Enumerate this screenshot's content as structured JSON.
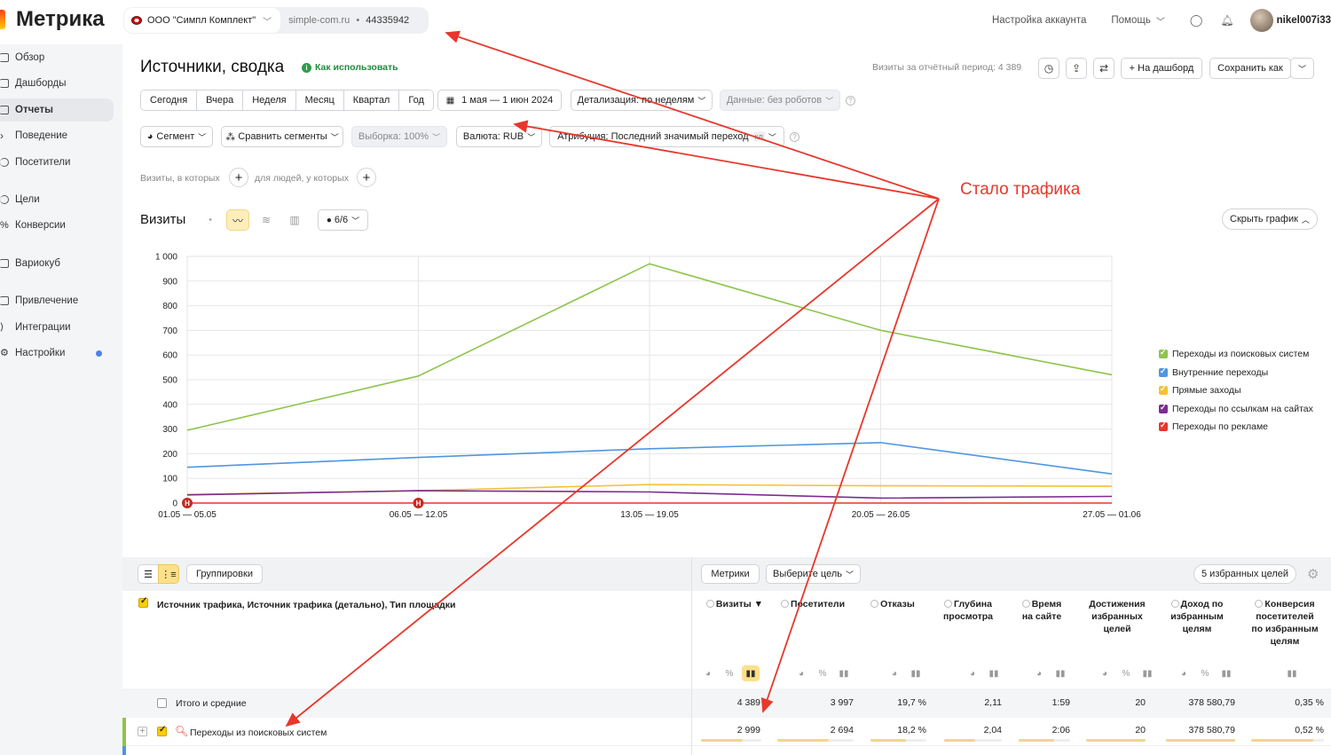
{
  "app": {
    "logo": "Метрика"
  },
  "counter": {
    "org": "ООО \"Симпл Комплект\"",
    "site": "simple-com.ru",
    "separator": "•",
    "id": "44335942"
  },
  "header": {
    "account_settings": "Настройка аккаунта",
    "help": "Помощь",
    "user": "nikel007i33"
  },
  "sidebar": {
    "items": [
      {
        "label": "Обзор"
      },
      {
        "label": "Дашборды"
      },
      {
        "label": "Отчеты"
      },
      {
        "label": "Поведение"
      },
      {
        "label": "Посетители"
      },
      {
        "label": "Цели"
      },
      {
        "label": "Конверсии"
      },
      {
        "label": "Вариокуб"
      },
      {
        "label": "Привлечение"
      },
      {
        "label": "Интеграции"
      },
      {
        "label": "Настройки"
      }
    ],
    "active_index": 2
  },
  "page": {
    "title": "Источники, сводка",
    "how_to": "Как использовать",
    "period_visits": "Визиты за отчётный период: 4 389",
    "to_dashboard": "+ На дашборд",
    "save_as": "Сохранить как"
  },
  "period_buttons": [
    "Сегодня",
    "Вчера",
    "Неделя",
    "Месяц",
    "Квартал",
    "Год"
  ],
  "date_range": "1 мая — 1 июн 2024",
  "detail": "Детализация: по неделям",
  "data_robots": "Данные: без роботов",
  "segment": "Сегмент",
  "compare_segments": "Сравнить сегменты",
  "sample": "Выборка: 100%",
  "currency": "Валюта: RUB",
  "attribution": "Атрибуция: Последний значимый переход",
  "attribution_badge": "кл",
  "filters": {
    "visits_where": "Визиты, в которых",
    "people_where": "для людей, у которых"
  },
  "chart_header": {
    "title": "Визиты",
    "series_count": "6/6",
    "hide_chart": "Скрыть график"
  },
  "chart_data": {
    "type": "line",
    "x": [
      "01.05 — 05.05",
      "06.05 — 12.05",
      "13.05 — 19.05",
      "20.05 — 26.05",
      "27.05 — 01.06"
    ],
    "ylim": [
      0,
      1000
    ],
    "yticks": [
      "0",
      "100",
      "200",
      "300",
      "400",
      "500",
      "600",
      "700",
      "800",
      "900",
      "1 000"
    ],
    "grid": true,
    "legend_position": "right",
    "series": [
      {
        "name": "Переходы из поисковых систем",
        "color": "#8ec44d",
        "values": [
          295,
          515,
          970,
          700,
          520
        ]
      },
      {
        "name": "Внутренние переходы",
        "color": "#4f96e0",
        "values": [
          145,
          185,
          220,
          245,
          118
        ]
      },
      {
        "name": "Прямые заходы",
        "color": "#f5c233",
        "values": [
          35,
          50,
          75,
          70,
          68
        ]
      },
      {
        "name": "Переходы по ссылкам на сайтах",
        "color": "#7b2d8e",
        "values": [
          33,
          50,
          45,
          20,
          27
        ]
      },
      {
        "name": "Переходы по рекламе",
        "color": "#e8372c",
        "values": [
          0,
          0,
          0,
          0,
          0
        ]
      }
    ],
    "markers": [
      "Н",
      "Н"
    ]
  },
  "table": {
    "view_groupings": "Группировки",
    "metrics": "Метрики",
    "choose_goal": "Выберите цель",
    "favorites": "5 избранных целей",
    "dimension_header": "Источник трафика, Источник трафика (детально), Тип площадки",
    "columns": [
      {
        "label": "Визиты ▼"
      },
      {
        "label": "Посетители"
      },
      {
        "label": "Отказы"
      },
      {
        "label": "Глубина просмотра"
      },
      {
        "label": "Время на сайте"
      },
      {
        "label": "Достижения избранных целей"
      },
      {
        "label": "Доход по избранным целям"
      },
      {
        "label": "Конверсия посетителей по избранным целям"
      }
    ],
    "total": {
      "label": "Итого и средние",
      "values": [
        "4 389",
        "3 997",
        "19,7 %",
        "2,11",
        "1:59",
        "20",
        "378 580,79",
        "0,35 %"
      ]
    },
    "rows": [
      {
        "label": "Переходы из поисковых систем",
        "values": [
          "2 999",
          "2 694",
          "18,2 %",
          "2,04",
          "2:06",
          "20",
          "378 580,79",
          "0,52 %"
        ]
      }
    ]
  },
  "annotation": {
    "text": "Стало трафика",
    "color": "#e8372c"
  }
}
